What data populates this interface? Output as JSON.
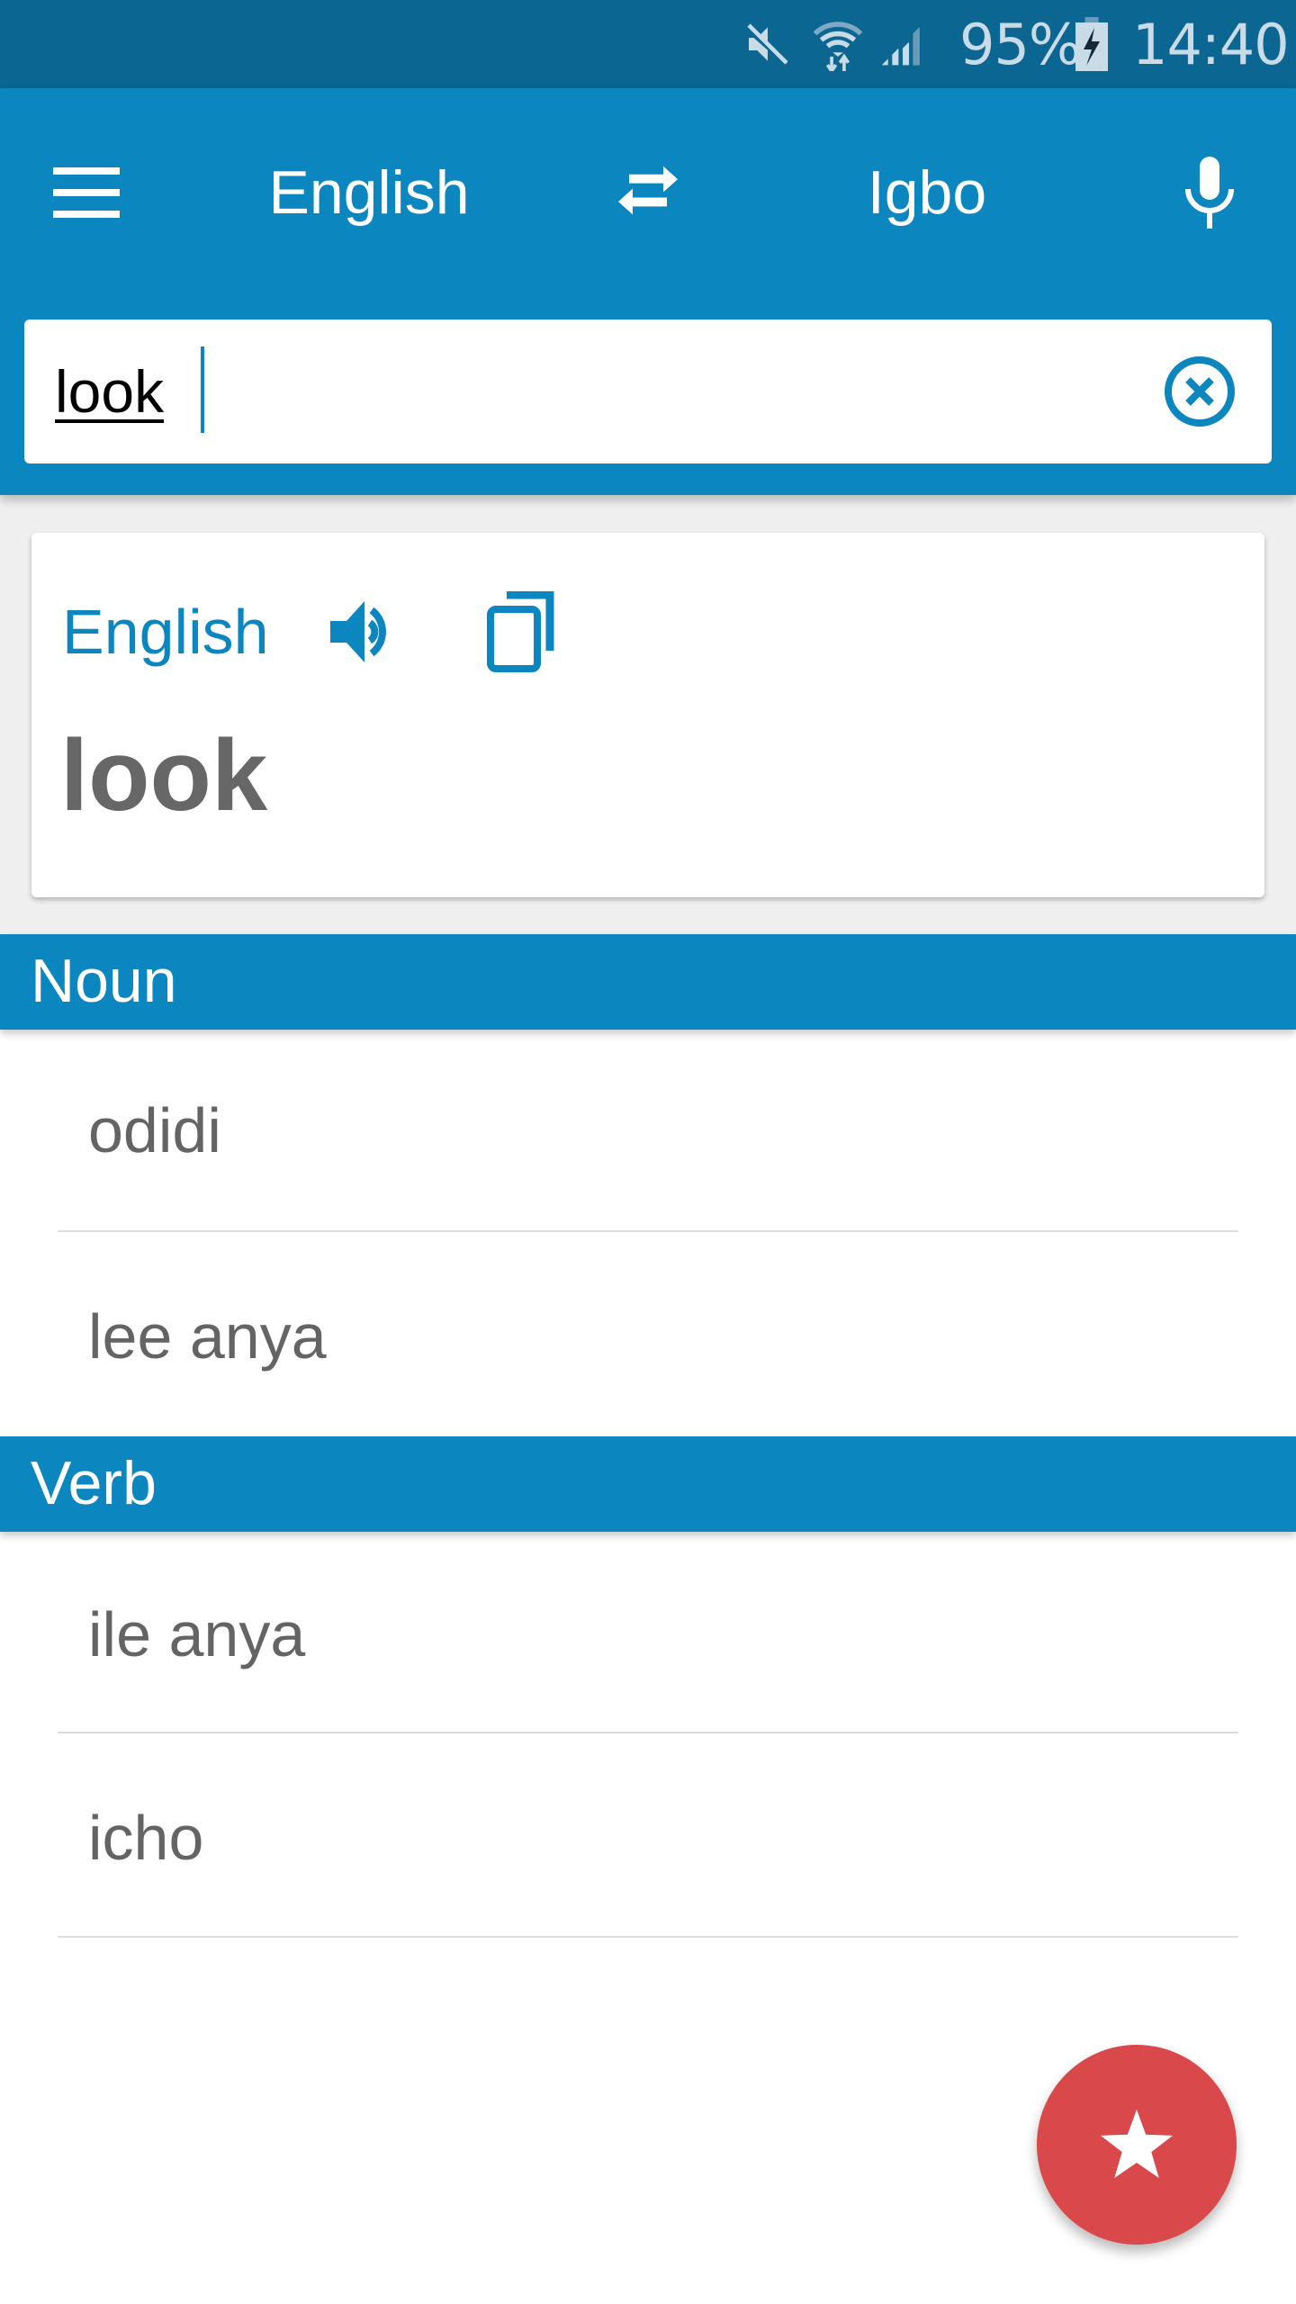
{
  "status_bar": {
    "icons": [
      "mute-icon",
      "wifi-icon",
      "signal-icon",
      "battery-charging-icon"
    ],
    "battery": "95%",
    "time": "14:40"
  },
  "toolbar": {
    "menu_icon": "menu-icon",
    "source_language": "English",
    "swap_icon": "swap-icon",
    "target_language": "Igbo",
    "mic_icon": "microphone-icon"
  },
  "search": {
    "value": "look",
    "clear_icon": "clear-icon"
  },
  "result_card": {
    "language": "English",
    "speaker_icon": "speaker-icon",
    "copy_icon": "copy-icon",
    "word": "look"
  },
  "sections": [
    {
      "label": "Noun",
      "items": [
        "odidi",
        "lee anya"
      ]
    },
    {
      "label": "Verb",
      "items": [
        "ile anya",
        "icho"
      ]
    }
  ],
  "fab": {
    "icon": "star-icon"
  },
  "colors": {
    "status_bar": "#0b6691",
    "primary": "#0c86bf",
    "fab": "#d9484a",
    "text_gray": "#646464"
  }
}
